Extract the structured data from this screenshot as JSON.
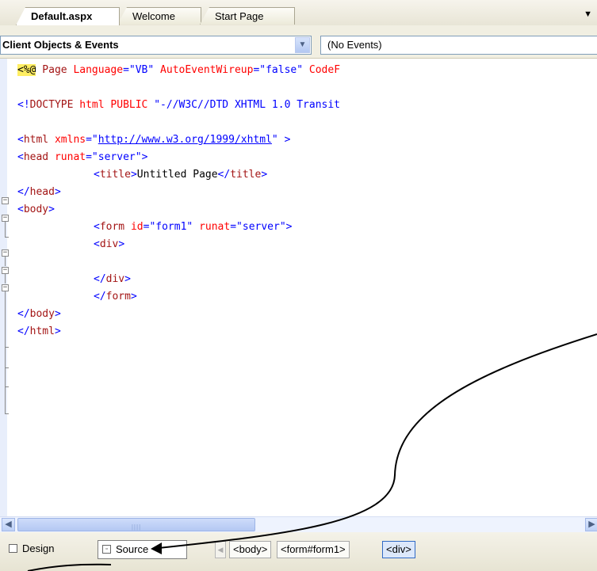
{
  "tabs": [
    {
      "label": "Default.aspx",
      "active": true
    },
    {
      "label": "Welcome",
      "active": false
    },
    {
      "label": "Start Page",
      "active": false
    }
  ],
  "navbar": {
    "objects_value": "Client Objects & Events",
    "events_value": "(No Events)"
  },
  "code": {
    "l1": {
      "a": "<%@",
      "b": " Page ",
      "c": "Language",
      "d": "=\"VB\"",
      "e": " AutoEventWireup",
      "f": "=\"false\"",
      "g": " CodeF"
    },
    "l2": {
      "a": "<!",
      "b": "DOCTYPE",
      "c": " html PUBLIC ",
      "d": "\"-//W3C//DTD XHTML 1.0 Transit"
    },
    "l3": {
      "a": "<",
      "b": "html",
      "c": " xmlns",
      "d": "=\"",
      "e": "http://www.w3.org/1999/xhtml",
      "f": "\"",
      "g": " >"
    },
    "l4": {
      "a": "<",
      "b": "head",
      "c": " runat",
      "d": "=\"server\"",
      "e": ">"
    },
    "l5": {
      "a": "<",
      "b": "title",
      "c": ">",
      "d": "Untitled Page",
      "e": "</",
      "f": "title",
      "g": ">"
    },
    "l6": {
      "a": "</",
      "b": "head",
      "c": ">"
    },
    "l7": {
      "a": "<",
      "b": "body",
      "c": ">"
    },
    "l8": {
      "a": "<",
      "b": "form",
      "c": " id",
      "d": "=\"form1\"",
      "e": " runat",
      "f": "=\"server\"",
      "g": ">"
    },
    "l9": {
      "a": "<",
      "b": "div",
      "c": ">"
    },
    "l10": {
      "a": "</",
      "b": "div",
      "c": ">"
    },
    "l11": {
      "a": "</",
      "b": "form",
      "c": ">"
    },
    "l12": {
      "a": "</",
      "b": "body",
      "c": ">"
    },
    "l13": {
      "a": "</",
      "b": "html",
      "c": ">"
    }
  },
  "bottom": {
    "design_label": "Design",
    "source_label": "Source",
    "breadcrumbs": [
      "<body>",
      "<form#form1>",
      "<div>"
    ]
  },
  "colors": {
    "tag_bracket": "#0000ff",
    "tag_name": "#a31515",
    "attribute": "#ff0000",
    "directive_highlight": "#ffee62"
  },
  "icons": [
    "dropdown-arrow-icon",
    "fold-collapse-icon",
    "scroll-left-icon",
    "scroll-right-icon",
    "design-view-icon",
    "source-view-icon",
    "tab-list-arrow-icon"
  ]
}
